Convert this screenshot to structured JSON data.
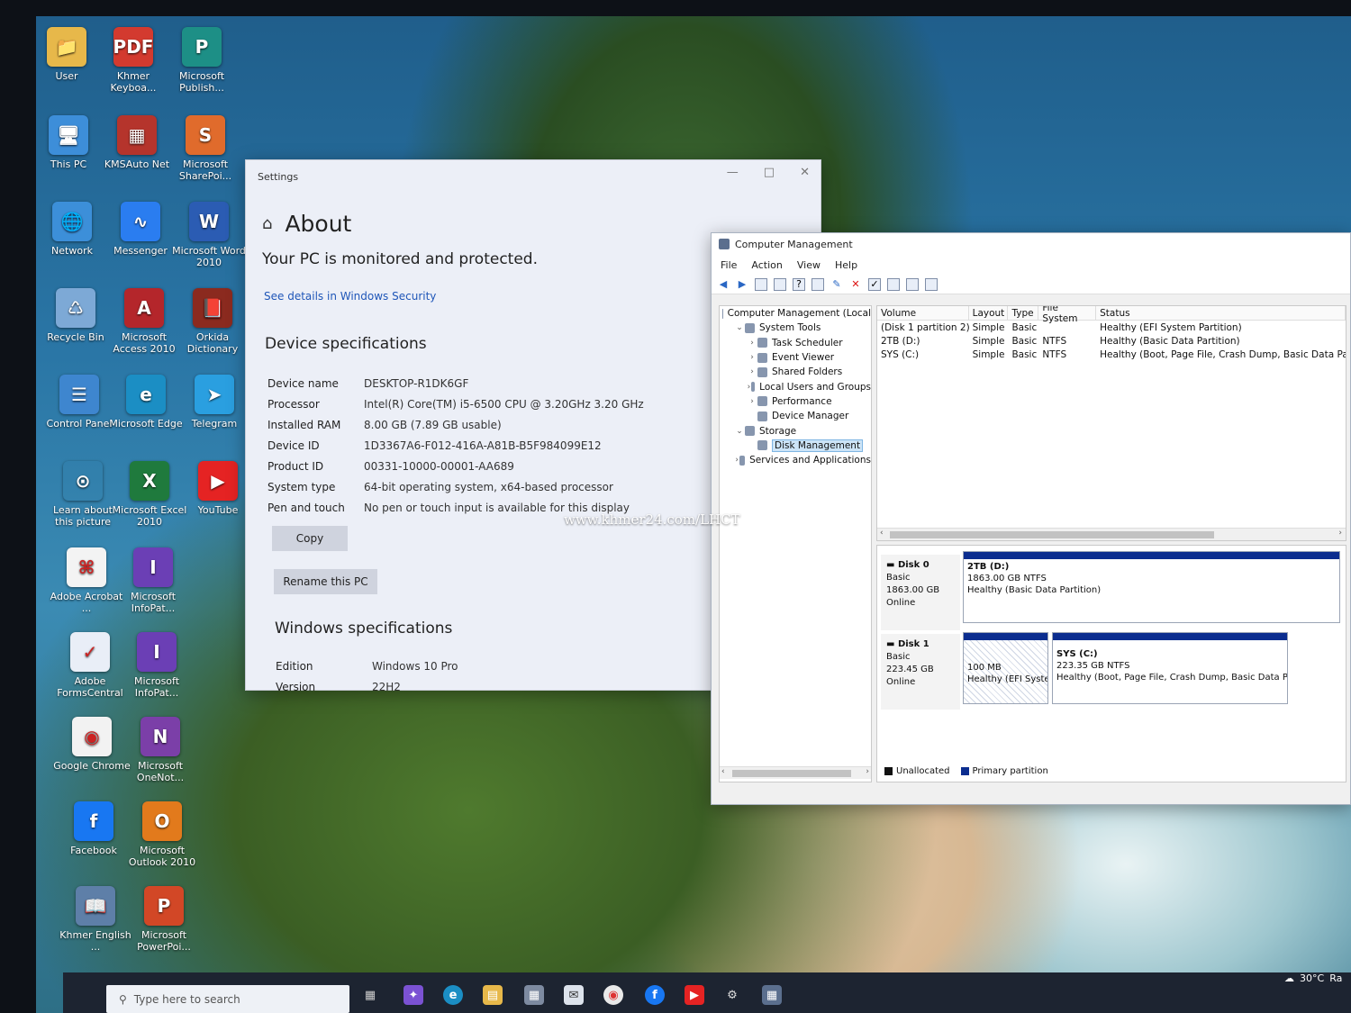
{
  "desktop": {
    "icons": [
      {
        "name": "User",
        "color": "#e7b84a",
        "glyph": "📁"
      },
      {
        "name": "Khmer Keyboa...",
        "color": "#d33a2f",
        "glyph": "PDF"
      },
      {
        "name": "Microsoft Publish...",
        "color": "#1d8f86",
        "glyph": "P"
      },
      {
        "name": "This PC",
        "color": "#3d8ed9",
        "glyph": "🖥"
      },
      {
        "name": "KMSAuto Net",
        "color": "#b5342c",
        "glyph": "▦"
      },
      {
        "name": "Microsoft SharePoi...",
        "color": "#e06b2c",
        "glyph": "S"
      },
      {
        "name": "Network",
        "color": "#3c8fd9",
        "glyph": "🌐"
      },
      {
        "name": "Messenger",
        "color": "#2a7df0",
        "glyph": "∿"
      },
      {
        "name": "Microsoft Word 2010",
        "color": "#2b5cb3",
        "glyph": "W"
      },
      {
        "name": "Recycle Bin",
        "color": "#7da9d6",
        "glyph": "♺"
      },
      {
        "name": "Microsoft Access 2010",
        "color": "#b4262b",
        "glyph": "A"
      },
      {
        "name": "Orkida Dictionary",
        "color": "#8b2a1f",
        "glyph": "📕"
      },
      {
        "name": "Control Panel",
        "color": "#3e86cf",
        "glyph": "☰"
      },
      {
        "name": "Microsoft Edge",
        "color": "#1b8ec4",
        "glyph": "e"
      },
      {
        "name": "Telegram",
        "color": "#2a9fe0",
        "glyph": "➤"
      },
      {
        "name": "Learn about this picture",
        "color": "rgba(0,0,0,0)",
        "glyph": "⊙"
      },
      {
        "name": "Microsoft Excel 2010",
        "color": "#1f7a3d",
        "glyph": "X"
      },
      {
        "name": "YouTube",
        "color": "#e52323",
        "glyph": "▶"
      },
      {
        "name": "Adobe Acrobat ...",
        "color": "#f3f3f3",
        "glyph": "⌘"
      },
      {
        "name": "Microsoft InfoPat...",
        "color": "#6b3fb5",
        "glyph": "I"
      },
      {
        "name": "Adobe FormsCentral",
        "color": "#e9eef7",
        "glyph": "✓"
      },
      {
        "name": "Microsoft InfoPat...",
        "color": "#6b3fb5",
        "glyph": "I"
      },
      {
        "name": "Google Chrome",
        "color": "#f2f2f2",
        "glyph": "◉"
      },
      {
        "name": "Microsoft OneNot...",
        "color": "#7b3fa8",
        "glyph": "N"
      },
      {
        "name": "Facebook",
        "color": "#1877f2",
        "glyph": "f"
      },
      {
        "name": "Microsoft Outlook 2010",
        "color": "#e27a1c",
        "glyph": "O"
      },
      {
        "name": "Khmer English ...",
        "color": "#5e7fa8",
        "glyph": "📖"
      },
      {
        "name": "Microsoft PowerPoi...",
        "color": "#d24726",
        "glyph": "P"
      }
    ]
  },
  "settings": {
    "window_title": "Settings",
    "heading": "About",
    "protection_text": "Your PC is monitored and protected.",
    "security_link": "See details in Windows Security",
    "device_specs_title": "Device specifications",
    "specs": [
      {
        "k": "Device name",
        "v": "DESKTOP-R1DK6GF"
      },
      {
        "k": "Processor",
        "v": "Intel(R) Core(TM) i5-6500 CPU @ 3.20GHz   3.20 GHz"
      },
      {
        "k": "Installed RAM",
        "v": "8.00 GB (7.89 GB usable)"
      },
      {
        "k": "Device ID",
        "v": "1D3367A6-F012-416A-A81B-B5F984099E12"
      },
      {
        "k": "Product ID",
        "v": "00331-10000-00001-AA689"
      },
      {
        "k": "System type",
        "v": "64-bit operating system, x64-based processor"
      },
      {
        "k": "Pen and touch",
        "v": "No pen or touch input is available for this display"
      }
    ],
    "copy_button": "Copy",
    "rename_button": "Rename this PC",
    "win_specs_title": "Windows specifications",
    "win_specs": [
      {
        "k": "Edition",
        "v": "Windows 10 Pro"
      },
      {
        "k": "Version",
        "v": "22H2"
      }
    ]
  },
  "cm": {
    "window_title": "Computer Management",
    "menu": [
      "File",
      "Action",
      "View",
      "Help"
    ],
    "tree": [
      {
        "label": "Computer Management (Local",
        "tw": "",
        "level": 0
      },
      {
        "label": "System Tools",
        "tw": "⌄",
        "level": 1
      },
      {
        "label": "Task Scheduler",
        "tw": "›",
        "level": 2
      },
      {
        "label": "Event Viewer",
        "tw": "›",
        "level": 2
      },
      {
        "label": "Shared Folders",
        "tw": "›",
        "level": 2
      },
      {
        "label": "Local Users and Groups",
        "tw": "›",
        "level": 2
      },
      {
        "label": "Performance",
        "tw": "›",
        "level": 2
      },
      {
        "label": "Device Manager",
        "tw": "",
        "level": 2
      },
      {
        "label": "Storage",
        "tw": "⌄",
        "level": 1
      },
      {
        "label": "Disk Management",
        "tw": "",
        "level": 2,
        "selected": true
      },
      {
        "label": "Services and Applications",
        "tw": "›",
        "level": 1
      }
    ],
    "columns": [
      "Volume",
      "Layout",
      "Type",
      "File System",
      "Status"
    ],
    "volumes": [
      {
        "vol": "(Disk 1 partition 2)",
        "layout": "Simple",
        "type": "Basic",
        "fs": "",
        "status": "Healthy (EFI System Partition)"
      },
      {
        "vol": "2TB (D:)",
        "layout": "Simple",
        "type": "Basic",
        "fs": "NTFS",
        "status": "Healthy (Basic Data Partition)"
      },
      {
        "vol": "SYS (C:)",
        "layout": "Simple",
        "type": "Basic",
        "fs": "NTFS",
        "status": "Healthy (Boot, Page File, Crash Dump, Basic Data Partitior"
      }
    ],
    "disks": [
      {
        "name": "Disk 0",
        "type": "Basic",
        "size": "1863.00 GB",
        "state": "Online",
        "partitions": [
          {
            "label": "2TB  (D:)",
            "size": "1863.00 GB NTFS",
            "status": "Healthy (Basic Data Partition)"
          }
        ]
      },
      {
        "name": "Disk 1",
        "type": "Basic",
        "size": "223.45 GB",
        "state": "Online",
        "partitions": [
          {
            "label": "",
            "size": "100 MB",
            "status": "Healthy (EFI Syster"
          },
          {
            "label": "SYS  (C:)",
            "size": "223.35 GB NTFS",
            "status": "Healthy (Boot, Page File, Crash Dump, Basic Data Part"
          }
        ]
      }
    ],
    "legend": [
      {
        "label": "Unallocated",
        "color": "#111111"
      },
      {
        "label": "Primary partition",
        "color": "#0b2d8f"
      }
    ]
  },
  "watermark": "www.khmer24.com/LHCT",
  "taskbar": {
    "search_placeholder": "Type here to search",
    "weather": "30°C",
    "weather_suffix": "Ra"
  }
}
